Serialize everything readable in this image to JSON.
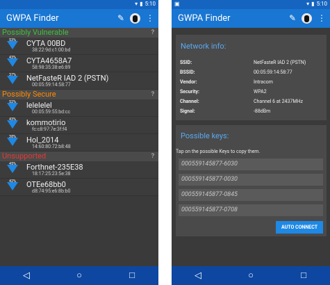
{
  "left": {
    "status_time": "5:10",
    "app_title": "GWPA Finder",
    "sections": [
      {
        "label": "Possibly Vulnerable",
        "color": "#3fbf3f",
        "help": "?",
        "items": [
          {
            "pct": "53%",
            "name": "CYTA 00BD",
            "mac": "38:22:9d:c1:00:bd"
          },
          {
            "pct": "43%",
            "name": "CYTA4658A7",
            "mac": "58:98:35:38:e6:89"
          },
          {
            "pct": "37%",
            "name": "NetFasteR IAD 2 (PSTN)",
            "mac": "00:05:59:14:58:77"
          }
        ]
      },
      {
        "label": "Possibly Secure",
        "color": "#ff8a00",
        "help": "?",
        "items": [
          {
            "pct": "52%",
            "name": "lelelelel",
            "mac": "00:05:59:55:bd:cc"
          },
          {
            "pct": "43%",
            "name": "kommotirio",
            "mac": "fc:c8:97:7e:3f:f4"
          },
          {
            "pct": "38%",
            "name": "Hol_2014",
            "mac": "14:60:80:72:b8:48"
          }
        ]
      },
      {
        "label": "Unsupported",
        "color": "#e53935",
        "help": "?",
        "items": [
          {
            "pct": "45%",
            "name": "Forthnet-235E38",
            "mac": "18:17:25:23:5e:38"
          },
          {
            "pct": "42%",
            "name": "OTEe68bb0",
            "mac": "d8:74:95:e6:8b:b0"
          }
        ]
      }
    ]
  },
  "right": {
    "status_time": "5:10",
    "app_title": "GWPA Finder",
    "network_info": {
      "title": "Network info:",
      "rows": [
        {
          "label": "SSID:",
          "value": "NetFasteR IAD 2 (PSTN)"
        },
        {
          "label": "BSSID:",
          "value": "00:05:59:14:58:77"
        },
        {
          "label": "Vendor:",
          "value": "Intracom"
        },
        {
          "label": "Security:",
          "value": "WPA2"
        },
        {
          "label": "Channel:",
          "value": "Channel 6 at 2437MHz"
        },
        {
          "label": "Signal:",
          "value": "-88dBm"
        }
      ]
    },
    "possible_keys": {
      "title": "Possible keys:",
      "hint": "Tap on the possible Keys to copy them.",
      "keys": [
        "000559145877-6030",
        "000559145877-0030",
        "000559145877-0845",
        "000559145877-0708"
      ],
      "button": "AUTO CONNECT"
    }
  },
  "nav": {
    "back": "◁",
    "home": "○",
    "recents": "□"
  },
  "icons": {
    "edit": "✎",
    "overflow": "⋮",
    "wifi": "▾",
    "battery": "▮"
  }
}
